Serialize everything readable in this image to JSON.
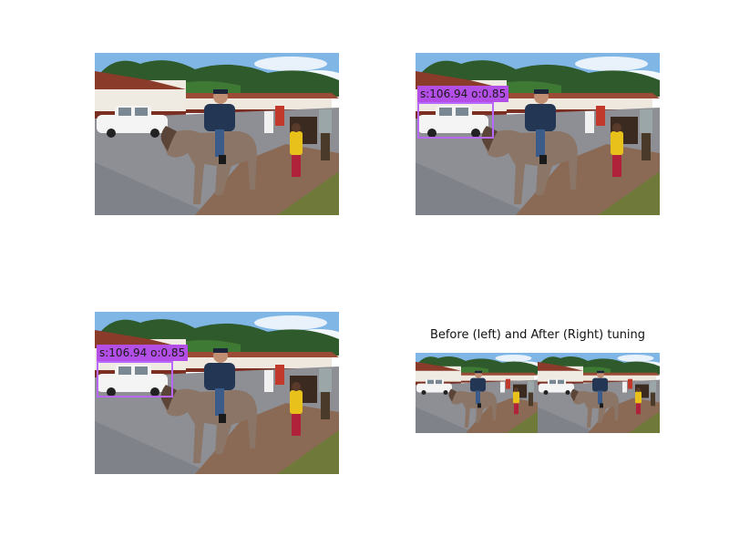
{
  "figure": {
    "caption": "Before (left) and After (Right) tuning"
  },
  "panels": [
    {
      "id": "original",
      "has_detection": false
    },
    {
      "id": "detection-right",
      "has_detection": true,
      "detection_label": "s:106.94 o:0.85"
    },
    {
      "id": "detection-left",
      "has_detection": true,
      "detection_label": "s:106.94 o:0.85"
    },
    {
      "id": "comparison",
      "has_detection": false
    }
  ],
  "colors": {
    "detection_box": "#b868ff",
    "detection_label_bg": "#b34ee6",
    "sky": "#7fb6e6",
    "road": "#8e8f95",
    "dirt": "#8b6a55",
    "trees": "#2f5a2b"
  }
}
